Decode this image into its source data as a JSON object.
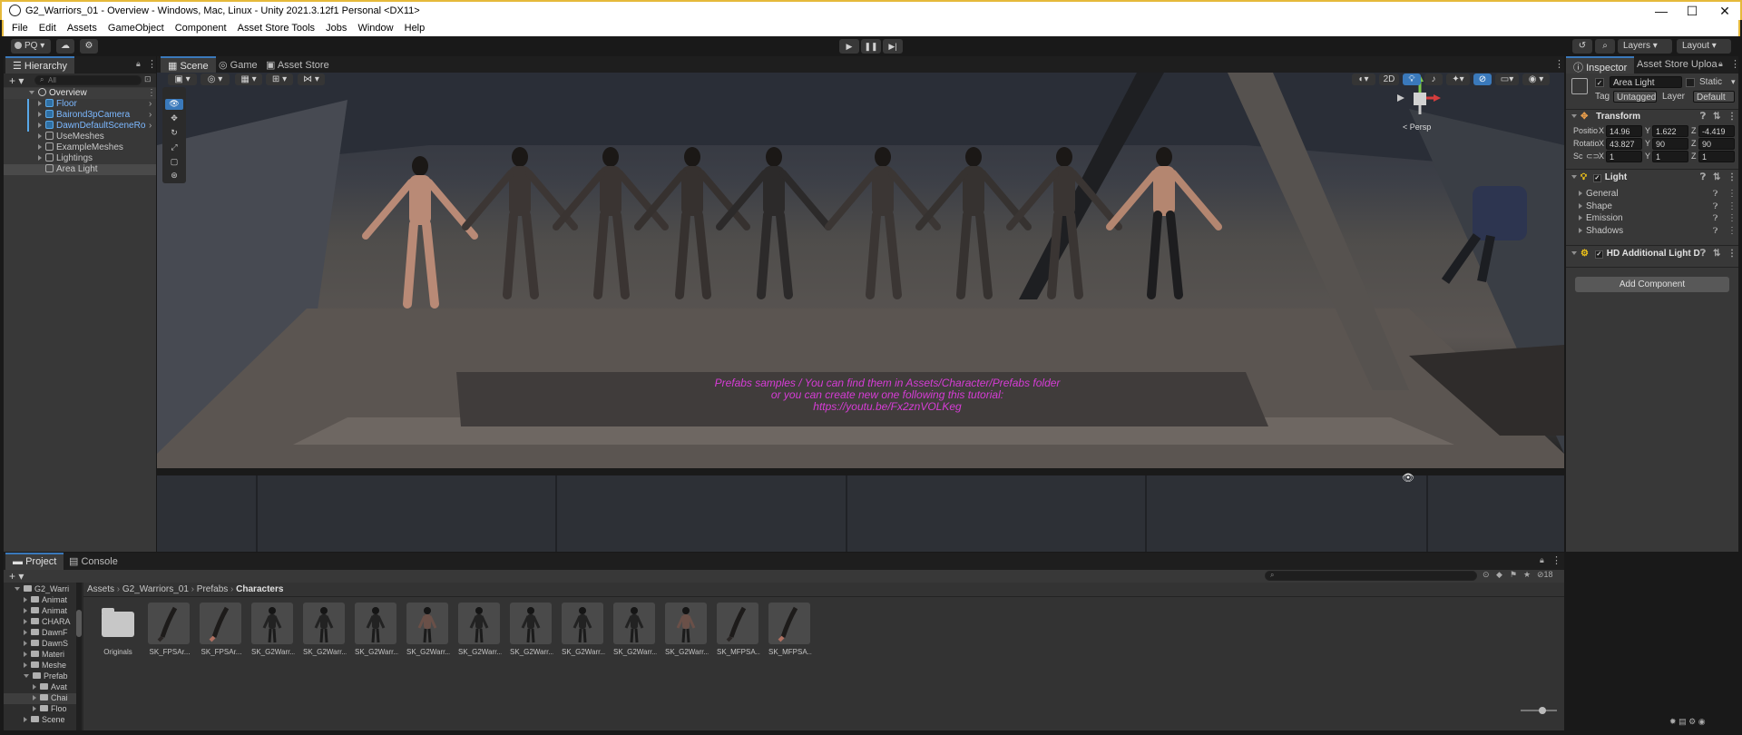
{
  "window": {
    "title": "G2_Warriors_01 - Overview - Windows, Mac, Linux - Unity 2021.3.12f1 Personal <DX11>",
    "minimize": "—",
    "maximize": "☐",
    "close": "✕"
  },
  "menu": [
    "File",
    "Edit",
    "Assets",
    "GameObject",
    "Component",
    "Asset Store Tools",
    "Jobs",
    "Window",
    "Help"
  ],
  "toolbar": {
    "account": "PQ",
    "layers": "Layers",
    "layout": "Layout"
  },
  "hierarchy": {
    "tab": "Hierarchy",
    "search_placeholder": "All",
    "scene": "Overview",
    "items": [
      {
        "label": "Floor",
        "prefab": true
      },
      {
        "label": "Bairond3pCamera",
        "prefab": true
      },
      {
        "label": "DawnDefaultSceneRo",
        "prefab": true
      },
      {
        "label": "UseMeshes",
        "prefab": false
      },
      {
        "label": "ExampleMeshes",
        "prefab": false
      },
      {
        "label": "Lightings",
        "prefab": false
      },
      {
        "label": "Area Light",
        "prefab": false
      }
    ]
  },
  "scene_tabs": [
    "Scene",
    "Game",
    "Asset Store"
  ],
  "scene_view": {
    "mode_2d": "2D",
    "persp": "< Persp",
    "info_line1": "Prefabs samples / You can find them in Assets/Character/Prefabs folder",
    "info_line2": "or you can create new one following this tutorial:",
    "info_line3": "https://youtu.be/Fx2znVOLKeg"
  },
  "inspector": {
    "tabs": [
      "Inspector",
      "Asset Store Uploa"
    ],
    "object_name": "Area Light",
    "static": "Static",
    "tag_label": "Tag",
    "tag_value": "Untagged",
    "layer_label": "Layer",
    "layer_value": "Default",
    "transform": {
      "title": "Transform",
      "position_label": "Positio",
      "rotation_label": "Rotatio",
      "scale_label": "Sc",
      "position": {
        "x": "14.96",
        "y": "1.622",
        "z": "-4.419"
      },
      "rotation": {
        "x": "43.827",
        "y": "90",
        "z": "90"
      },
      "scale": {
        "x": "1",
        "y": "1",
        "z": "1"
      }
    },
    "light": {
      "title": "Light",
      "sections": [
        "General",
        "Shape",
        "Emission",
        "Shadows"
      ]
    },
    "hdrp": "HD Additional Light D",
    "add_component": "Add Component"
  },
  "project": {
    "tabs": [
      "Project",
      "Console"
    ],
    "breadcrumb": [
      "Assets",
      "G2_Warriors_01",
      "Prefabs",
      "Characters"
    ],
    "count": "18",
    "tree": [
      {
        "label": "G2_Warri",
        "indent": 0,
        "open": true
      },
      {
        "label": "Animat",
        "indent": 1,
        "open": false
      },
      {
        "label": "Animat",
        "indent": 1,
        "open": false
      },
      {
        "label": "CHARA",
        "indent": 1,
        "open": false
      },
      {
        "label": "DawnF",
        "indent": 1,
        "open": false
      },
      {
        "label": "DawnS",
        "indent": 1,
        "open": false
      },
      {
        "label": "Materi",
        "indent": 1,
        "open": false
      },
      {
        "label": "Meshe",
        "indent": 1,
        "open": false
      },
      {
        "label": "Prefab",
        "indent": 1,
        "open": true
      },
      {
        "label": "Avat",
        "indent": 2,
        "open": false
      },
      {
        "label": "Chai",
        "indent": 2,
        "open": false
      },
      {
        "label": "Floo",
        "indent": 2,
        "open": false
      },
      {
        "label": "Scene",
        "indent": 1,
        "open": false
      }
    ],
    "assets": [
      "Originals",
      "SK_FPSAr...",
      "SK_FPSAr...",
      "SK_G2Warr...",
      "SK_G2Warr...",
      "SK_G2Warr...",
      "SK_G2Warr...",
      "SK_G2Warr...",
      "SK_G2Warr...",
      "SK_G2Warr...",
      "SK_G2Warr...",
      "SK_G2Warr...",
      "SK_MFPSA...",
      "SK_MFPSA..."
    ]
  },
  "colors": {
    "accent": "#3a79bb",
    "prefab_blue": "#7cb8ff",
    "info_text": "#d63cd6",
    "title_border": "#e5b93b"
  }
}
